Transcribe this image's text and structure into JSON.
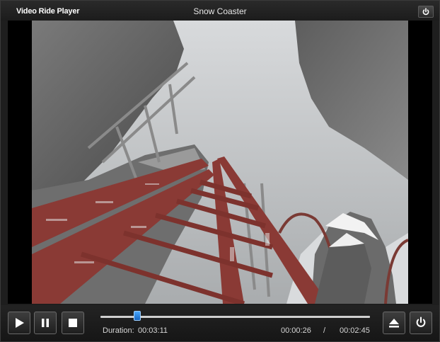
{
  "window": {
    "app_name": "Video Ride Player",
    "video_title": "Snow Coaster"
  },
  "icons": {
    "title_power": "power-icon",
    "play": "play-icon",
    "pause": "pause-icon",
    "stop": "stop-icon",
    "eject": "eject-icon",
    "power": "power-icon"
  },
  "playback": {
    "duration_label": "Duration:",
    "duration_value": "00:03:11",
    "elapsed": "00:00:26",
    "separator": "/",
    "remaining": "00:02:45",
    "progress": 0.136
  },
  "colors": {
    "accent": "#1e88e5",
    "track_rust": "#8a3a35"
  }
}
